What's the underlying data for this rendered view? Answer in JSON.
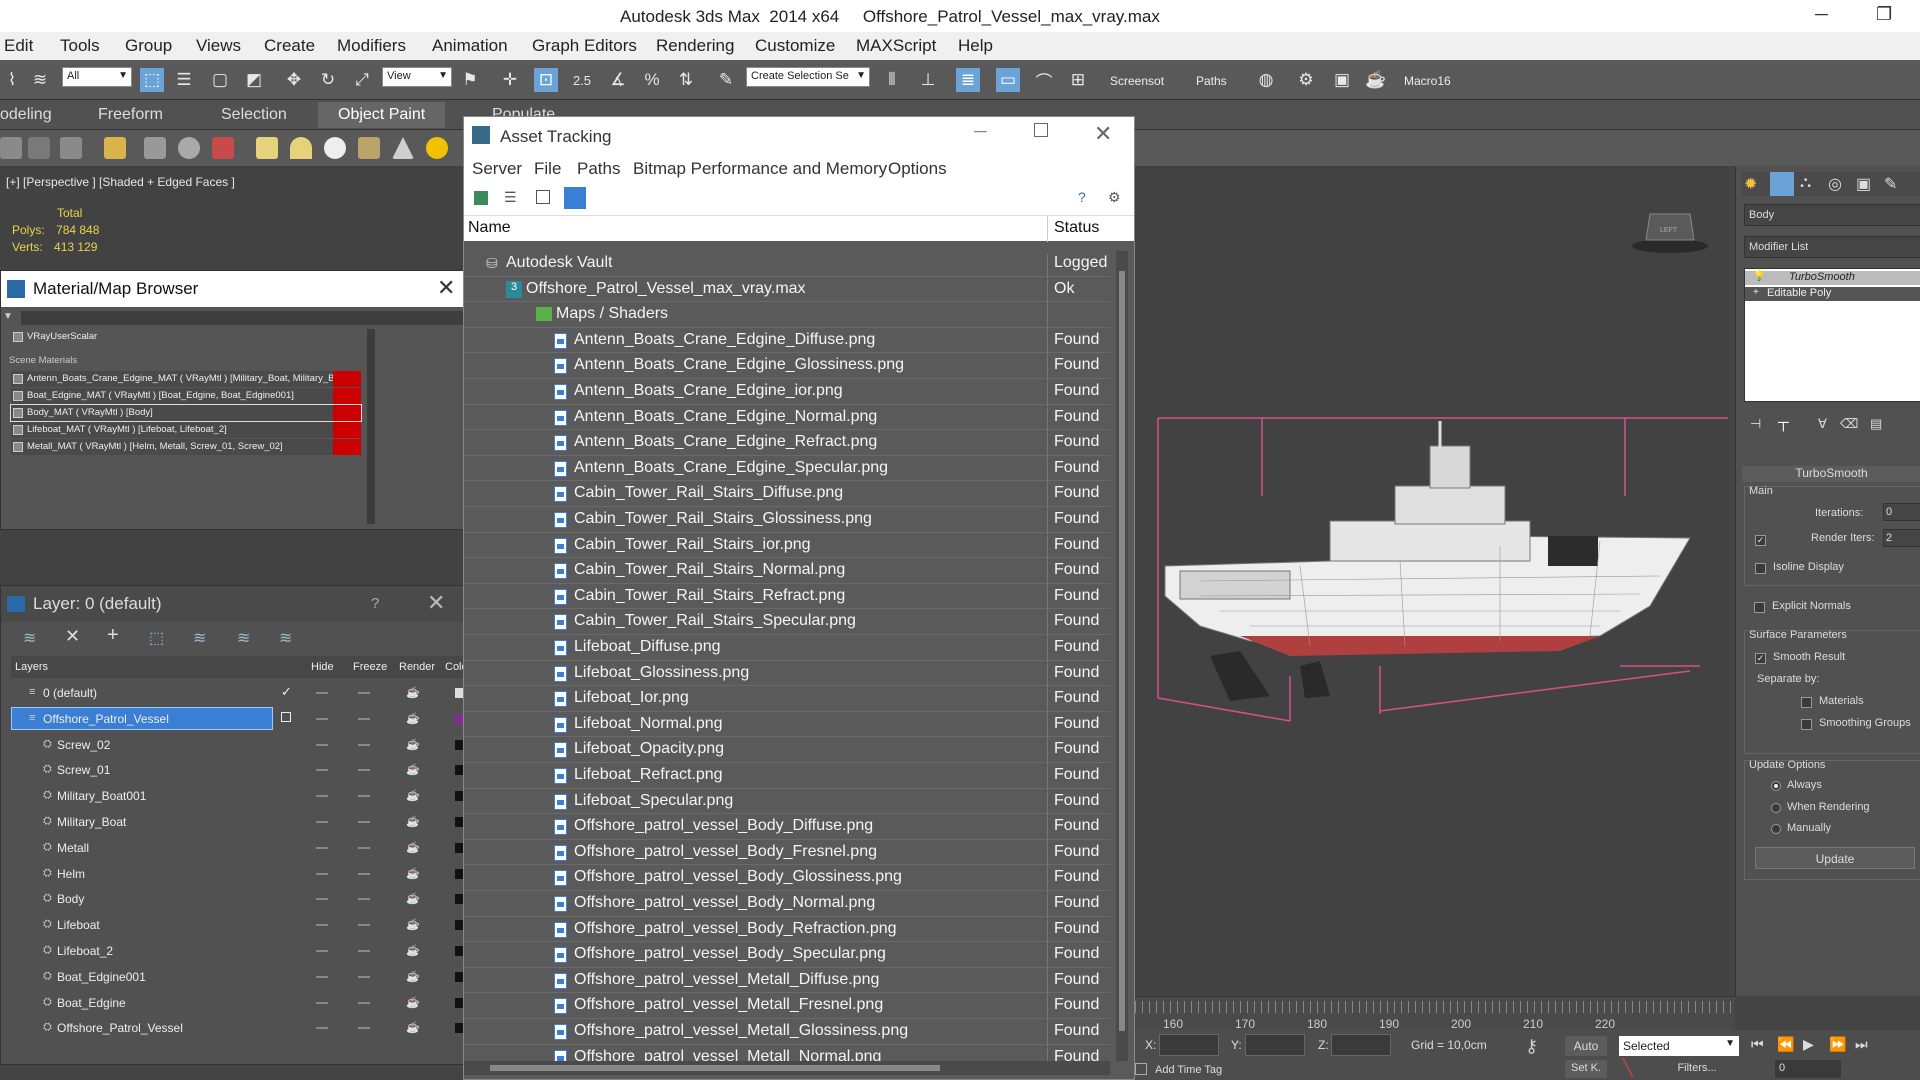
{
  "window": {
    "title": "Autodesk 3ds Max  2014 x64     Offshore_Patrol_Vessel_max_vray.max",
    "minimize": "─",
    "maximize": "❐"
  },
  "menubar": [
    "Edit",
    "Tools",
    "Group",
    "Views",
    "Create",
    "Modifiers",
    "Animation",
    "Graph Editors",
    "Rendering",
    "Customize",
    "MAXScript",
    "Help"
  ],
  "toolbar": {
    "selection_filter": "All",
    "ref_coord": "View",
    "named_selection": "Create Selection Se",
    "snap_label": "2.5",
    "screenshot_label": "Screensot",
    "paths_label": "Paths",
    "macro_label": "Macro16"
  },
  "ribbon_tabs": [
    "odeling",
    "Freeform",
    "Selection",
    "Object Paint",
    "Populate"
  ],
  "viewport": {
    "label": "[+] [Perspective ] [Shaded + Edged Faces ]",
    "stats_total": "Total",
    "polys_label": "Polys:",
    "polys_value": "784 848",
    "verts_label": "Verts:",
    "verts_value": "413 129",
    "viewcube_label": "LEFT"
  },
  "material_browser": {
    "title": "Material/Map Browser",
    "scalar_item": "VRayUserScalar",
    "section": "Scene Materials",
    "materials": [
      "Antenn_Boats_Crane_Edgine_MAT ( VRayMtl ) [Military_Boat, Military_Bo...",
      "Boat_Edgine_MAT ( VRayMtl ) [Boat_Edgine, Boat_Edgine001]",
      "Body_MAT ( VRayMtl ) [Body]",
      "Lifeboat_MAT ( VRayMtl ) [Lifeboat, Lifeboat_2]",
      "Metall_MAT ( VRayMtl ) [Helm, Metall, Screw_01, Screw_02]"
    ]
  },
  "layer_panel": {
    "title": "Layer: 0 (default)",
    "help": "?",
    "columns": [
      "Layers",
      "Hide",
      "Freeze",
      "Render",
      "Colo"
    ],
    "layers": [
      {
        "name": "0 (default)",
        "indent": 1
      },
      {
        "name": "Offshore_Patrol_Vessel",
        "indent": 1,
        "selected": true
      },
      {
        "name": "Screw_02",
        "indent": 2
      },
      {
        "name": "Screw_01",
        "indent": 2
      },
      {
        "name": "Military_Boat001",
        "indent": 2
      },
      {
        "name": "Military_Boat",
        "indent": 2
      },
      {
        "name": "Metall",
        "indent": 2
      },
      {
        "name": "Helm",
        "indent": 2
      },
      {
        "name": "Body",
        "indent": 2
      },
      {
        "name": "Lifeboat",
        "indent": 2
      },
      {
        "name": "Lifeboat_2",
        "indent": 2
      },
      {
        "name": "Boat_Edgine001",
        "indent": 2
      },
      {
        "name": "Boat_Edgine",
        "indent": 2
      },
      {
        "name": "Offshore_Patrol_Vessel",
        "indent": 2
      }
    ]
  },
  "asset_tracking": {
    "title": "Asset Tracking",
    "menu": [
      "Server",
      "File",
      "Paths",
      "Bitmap Performance and Memory",
      "Options"
    ],
    "col_name": "Name",
    "col_status": "Status",
    "rows": [
      {
        "name": "Autodesk Vault",
        "status": "Logged Out",
        "level": 1,
        "icon": "vault"
      },
      {
        "name": "Offshore_Patrol_Vessel_max_vray.max",
        "status": "Ok",
        "level": 2,
        "icon": "max"
      },
      {
        "name": "Maps / Shaders",
        "status": "",
        "level": 3,
        "icon": "folder"
      },
      {
        "name": "Antenn_Boats_Crane_Edgine_Diffuse.png",
        "status": "Found",
        "level": 4,
        "icon": "file"
      },
      {
        "name": "Antenn_Boats_Crane_Edgine_Glossiness.png",
        "status": "Found",
        "level": 4,
        "icon": "file"
      },
      {
        "name": "Antenn_Boats_Crane_Edgine_ior.png",
        "status": "Found",
        "level": 4,
        "icon": "file"
      },
      {
        "name": "Antenn_Boats_Crane_Edgine_Normal.png",
        "status": "Found",
        "level": 4,
        "icon": "file"
      },
      {
        "name": "Antenn_Boats_Crane_Edgine_Refract.png",
        "status": "Found",
        "level": 4,
        "icon": "file"
      },
      {
        "name": "Antenn_Boats_Crane_Edgine_Specular.png",
        "status": "Found",
        "level": 4,
        "icon": "file"
      },
      {
        "name": "Cabin_Tower_Rail_Stairs_Diffuse.png",
        "status": "Found",
        "level": 4,
        "icon": "file"
      },
      {
        "name": "Cabin_Tower_Rail_Stairs_Glossiness.png",
        "status": "Found",
        "level": 4,
        "icon": "file"
      },
      {
        "name": "Cabin_Tower_Rail_Stairs_ior.png",
        "status": "Found",
        "level": 4,
        "icon": "file"
      },
      {
        "name": "Cabin_Tower_Rail_Stairs_Normal.png",
        "status": "Found",
        "level": 4,
        "icon": "file"
      },
      {
        "name": "Cabin_Tower_Rail_Stairs_Refract.png",
        "status": "Found",
        "level": 4,
        "icon": "file"
      },
      {
        "name": "Cabin_Tower_Rail_Stairs_Specular.png",
        "status": "Found",
        "level": 4,
        "icon": "file"
      },
      {
        "name": "Lifeboat_Diffuse.png",
        "status": "Found",
        "level": 4,
        "icon": "file"
      },
      {
        "name": "Lifeboat_Glossiness.png",
        "status": "Found",
        "level": 4,
        "icon": "file"
      },
      {
        "name": "Lifeboat_Ior.png",
        "status": "Found",
        "level": 4,
        "icon": "file"
      },
      {
        "name": "Lifeboat_Normal.png",
        "status": "Found",
        "level": 4,
        "icon": "file"
      },
      {
        "name": "Lifeboat_Opacity.png",
        "status": "Found",
        "level": 4,
        "icon": "file"
      },
      {
        "name": "Lifeboat_Refract.png",
        "status": "Found",
        "level": 4,
        "icon": "file"
      },
      {
        "name": "Lifeboat_Specular.png",
        "status": "Found",
        "level": 4,
        "icon": "file"
      },
      {
        "name": "Offshore_patrol_vessel_Body_Diffuse.png",
        "status": "Found",
        "level": 4,
        "icon": "file"
      },
      {
        "name": "Offshore_patrol_vessel_Body_Fresnel.png",
        "status": "Found",
        "level": 4,
        "icon": "file"
      },
      {
        "name": "Offshore_patrol_vessel_Body_Glossiness.png",
        "status": "Found",
        "level": 4,
        "icon": "file"
      },
      {
        "name": "Offshore_patrol_vessel_Body_Normal.png",
        "status": "Found",
        "level": 4,
        "icon": "file"
      },
      {
        "name": "Offshore_patrol_vessel_Body_Refraction.png",
        "status": "Found",
        "level": 4,
        "icon": "file"
      },
      {
        "name": "Offshore_patrol_vessel_Body_Specular.png",
        "status": "Found",
        "level": 4,
        "icon": "file"
      },
      {
        "name": "Offshore_patrol_vessel_Metall_Diffuse.png",
        "status": "Found",
        "level": 4,
        "icon": "file"
      },
      {
        "name": "Offshore_patrol_vessel_Metall_Fresnel.png",
        "status": "Found",
        "level": 4,
        "icon": "file"
      },
      {
        "name": "Offshore_patrol_vessel_Metall_Glossiness.png",
        "status": "Found",
        "level": 4,
        "icon": "file"
      },
      {
        "name": "Offshore_patrol_vessel_Metall_Normal.png",
        "status": "Found",
        "level": 4,
        "icon": "file"
      }
    ]
  },
  "command_panel": {
    "object_name": "Body",
    "modifier_list": "Modifier List",
    "stack": [
      "TurboSmooth",
      "Editable Poly"
    ],
    "rollout_title": "TurboSmooth",
    "main_group": "Main",
    "iterations_label": "Iterations:",
    "iterations_value": "0",
    "render_iters_label": "Render Iters:",
    "render_iters_value": "2",
    "isoline_label": "Isoline Display",
    "explicit_normals_label": "Explicit Normals",
    "surface_group": "Surface Parameters",
    "smooth_result_label": "Smooth Result",
    "separate_by_label": "Separate by:",
    "materials_label": "Materials",
    "smoothing_groups_label": "Smoothing Groups",
    "update_group": "Update Options",
    "always_label": "Always",
    "when_rendering_label": "When Rendering",
    "manually_label": "Manually",
    "update_button": "Update",
    "check_mark": "✓"
  },
  "timeline": {
    "ticks": [
      "160",
      "170",
      "180",
      "190",
      "200",
      "210",
      "220"
    ]
  },
  "status": {
    "x_label": "X:",
    "y_label": "Y:",
    "z_label": "Z:",
    "grid": "Grid = 10,0cm",
    "auto_label": "Auto",
    "selected_value": "Selected",
    "setk_label": "Set K.",
    "filters_label": "Filters...",
    "add_time_tag": "Add Time Tag",
    "frame_value": "0"
  },
  "colors": {
    "accent": "#6ba3d6",
    "material_swatch": "#cc0000",
    "layer_selected": "#3a7fd4",
    "stats": "#e8d34a",
    "bbox": "#d4508a"
  }
}
